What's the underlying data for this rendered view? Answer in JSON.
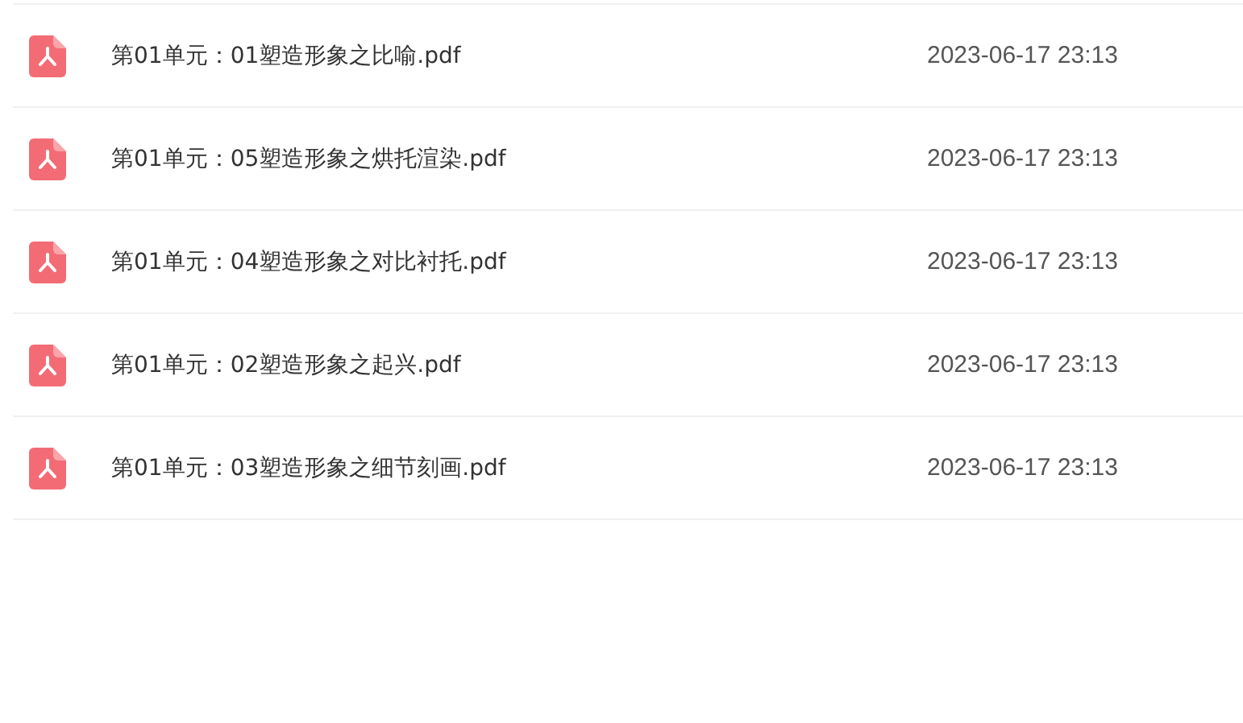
{
  "files": [
    {
      "kind": "pdf",
      "name": "第01单元：01塑造形象之比喻.pdf",
      "date": "2023-06-17 23:13"
    },
    {
      "kind": "pdf",
      "name": "第01单元：05塑造形象之烘托渲染.pdf",
      "date": "2023-06-17 23:13"
    },
    {
      "kind": "pdf",
      "name": "第01单元：04塑造形象之对比衬托.pdf",
      "date": "2023-06-17 23:13"
    },
    {
      "kind": "pdf",
      "name": "第01单元：02塑造形象之起兴.pdf",
      "date": "2023-06-17 23:13"
    },
    {
      "kind": "pdf",
      "name": "第01单元：03塑造形象之细节刻画.pdf",
      "date": "2023-06-17 23:13"
    }
  ]
}
